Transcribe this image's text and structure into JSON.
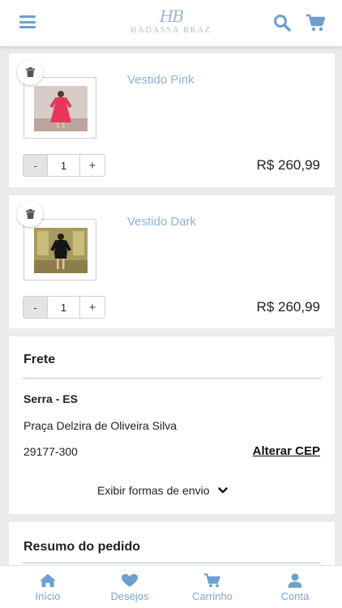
{
  "header": {
    "menu_icon": "hamburger-menu-icon",
    "logo_monogram": "HB",
    "logo_text": "HADASSA BRAZ",
    "search_icon": "search-icon",
    "cart_icon": "shopping-cart-icon"
  },
  "cart_items": [
    {
      "name": "Vestido Pink",
      "quantity": "1",
      "minus_label": "-",
      "plus_label": "+",
      "price": "R$ 260,99",
      "remove_icon": "trash-icon"
    },
    {
      "name": "Vestido Dark",
      "quantity": "1",
      "minus_label": "-",
      "plus_label": "+",
      "price": "R$ 260,99",
      "remove_icon": "trash-icon"
    }
  ],
  "frete": {
    "title": "Frete",
    "city": "Serra - ES",
    "street": "Praça Delzira de Oliveira Silva",
    "cep": "29177-300",
    "change_link": "Alterar CEP",
    "show_options": "Exibir formas de envio"
  },
  "resumo": {
    "title": "Resumo do pedido"
  },
  "tabbar": [
    {
      "label": "Início",
      "icon": "home-icon"
    },
    {
      "label": "Desejos",
      "icon": "heart-icon"
    },
    {
      "label": "Carrinho",
      "icon": "cart-icon"
    },
    {
      "label": "Conta",
      "icon": "user-icon"
    }
  ],
  "colors": {
    "accent": "#6d9fcf",
    "product_name": "#8eb3d8",
    "tab_label": "#7ba6d2",
    "background": "#ebebeb"
  }
}
